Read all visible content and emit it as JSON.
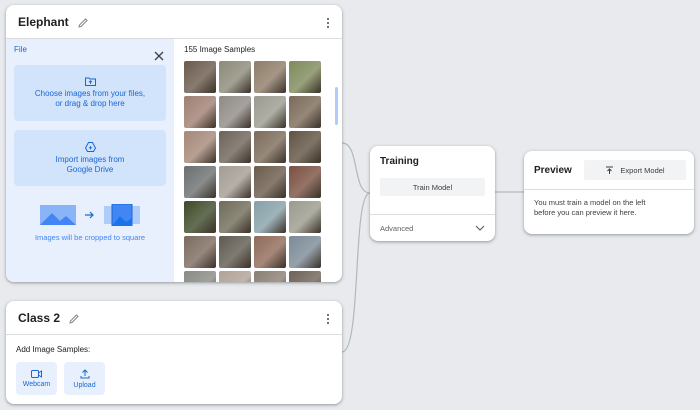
{
  "class1": {
    "title": "Elephant",
    "file_label": "File",
    "choose_text_1": "Choose images from your files,",
    "choose_text_2": "or drag & drop here",
    "drive_text_1": "Import images from",
    "drive_text_2": "Google Drive",
    "crop_note": "Images will be cropped to square",
    "samples_count": "155 Image Samples"
  },
  "class2": {
    "title": "Class 2",
    "add_label": "Add Image Samples:",
    "webcam_label": "Webcam",
    "upload_label": "Upload"
  },
  "training": {
    "title": "Training",
    "train_button": "Train Model",
    "advanced_label": "Advanced"
  },
  "preview": {
    "title": "Preview",
    "export_button": "Export Model",
    "message_1": "You must train a model on the left",
    "message_2": "before you can preview it here."
  },
  "colors": {
    "thumbs": [
      "#6b5a4c",
      "#8c8a78",
      "#8e7c68",
      "#7e8a5a",
      "#a07f72",
      "#8f8a86",
      "#9b9a8f",
      "#7a6a58",
      "#a58878",
      "#6d6257",
      "#7c6b59",
      "#5f5242",
      "#6b6f6f",
      "#a39c93",
      "#6a5a4a",
      "#7a5040",
      "#3e4a2a",
      "#6f6b58",
      "#86a0a8",
      "#9a9a8c",
      "#7c6a5e",
      "#5e5a50",
      "#8f6a58",
      "#7a8a96",
      "#8a8a84",
      "#b0a296",
      "#8b7f73",
      "#6f6257"
    ]
  }
}
